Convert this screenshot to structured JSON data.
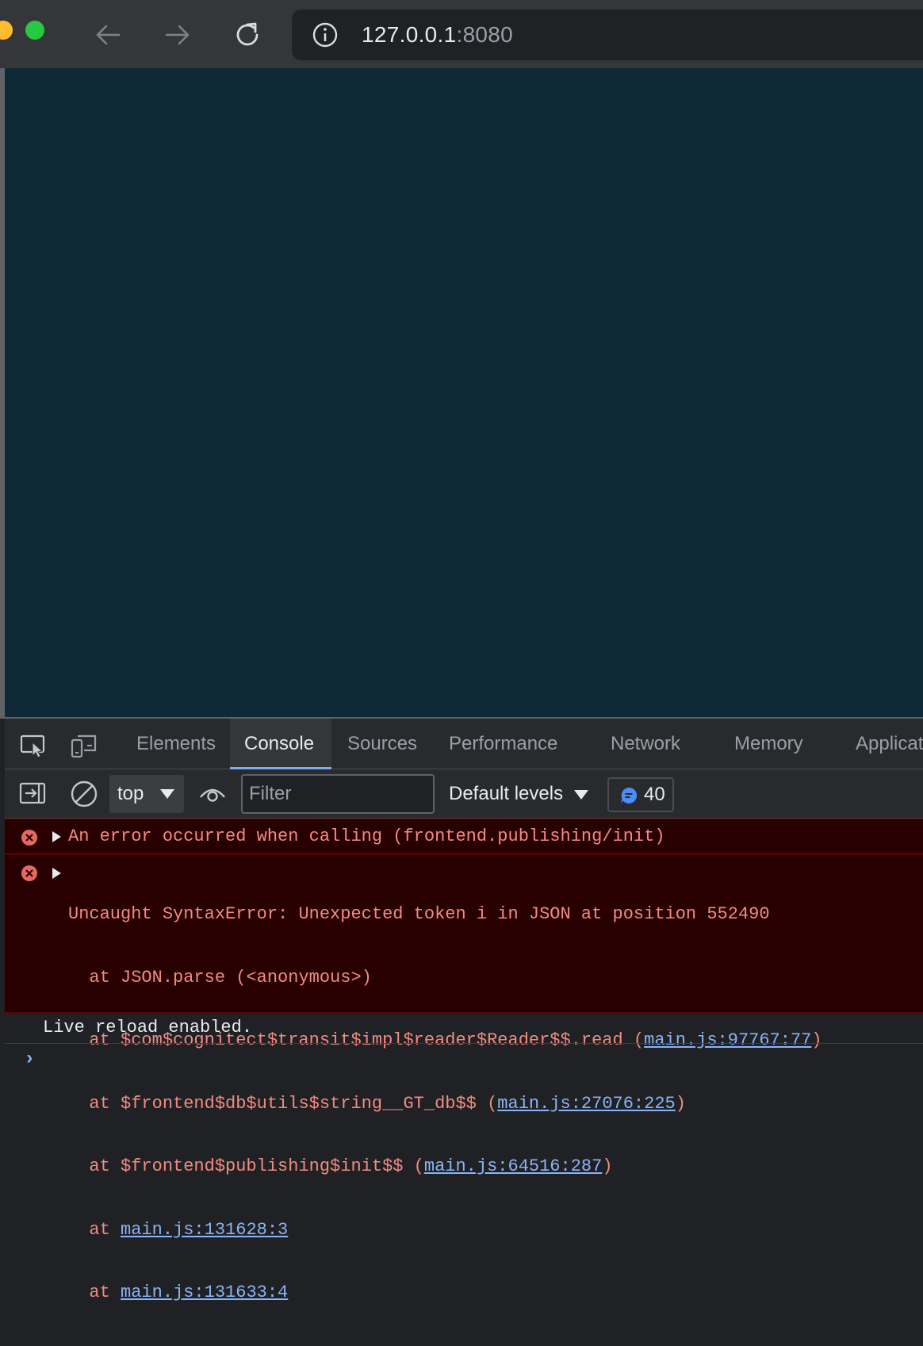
{
  "browser": {
    "url_host": "127.0.0.1",
    "url_port": ":8080"
  },
  "devtools": {
    "tabs": [
      {
        "label": "Elements"
      },
      {
        "label": "Console"
      },
      {
        "label": "Sources"
      },
      {
        "label": "Performance"
      },
      {
        "label": "Network"
      },
      {
        "label": "Memory"
      },
      {
        "label": "Applicat"
      }
    ],
    "active_tab": "Console",
    "console_bar": {
      "context": "top",
      "filter_placeholder": "Filter",
      "levels": "Default levels",
      "issues_count": "40"
    },
    "messages": {
      "error1": "An error occurred when calling (frontend.publishing/init)",
      "error2": {
        "headline": "Uncaught SyntaxError: Unexpected token i in JSON at position 552490",
        "line1": "  at JSON.parse (<anonymous>)",
        "line2_prefix": "  at $com$cognitect$transit$impl$reader$Reader$$.read (",
        "line2_link": "main.js:97767:77",
        "line3_prefix": "  at $frontend$db$utils$string__GT_db$$ (",
        "line3_link": "main.js:27076:225",
        "line4_prefix": "  at $frontend$publishing$init$$ (",
        "line4_link": "main.js:64516:287",
        "line5_prefix": "  at ",
        "line5_link": "main.js:131628:3",
        "line6_prefix": "  at ",
        "line6_link": "main.js:131633:4",
        "close_paren": ")"
      },
      "log1": "Live reload enabled."
    },
    "prompt_symbol": "›"
  },
  "colors": {
    "viewport_bg": "#0f2a36",
    "error_bg": "#290000",
    "error_text": "#f28b82",
    "link": "#8ab4f8",
    "tab_underline": "#7cacf8"
  }
}
